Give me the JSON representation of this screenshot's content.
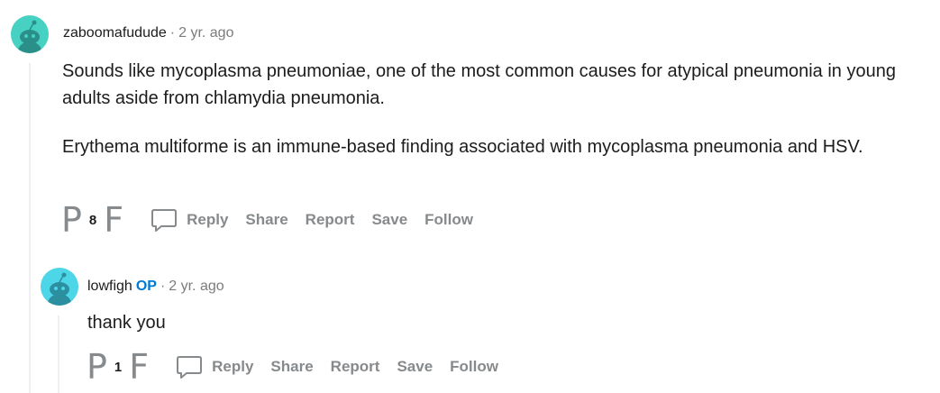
{
  "comments": [
    {
      "username": "zaboomafudude",
      "op_badge": "",
      "separator": "·",
      "time": "2 yr. ago",
      "paragraphs": [
        "Sounds like mycoplasma pneumoniae, one of the most common causes for atypical pneumonia in young adults aside from chlamydia pneumonia.",
        "Erythema multiforme is an immune-based finding associated with mycoplasma pneumonia and HSV."
      ],
      "score": "8",
      "upvote_glyph": "P",
      "downvote_glyph": "F",
      "actions": {
        "reply": "Reply",
        "share": "Share",
        "report": "Report",
        "save": "Save",
        "follow": "Follow"
      }
    },
    {
      "username": "lowfigh",
      "op_badge": "OP",
      "separator": "·",
      "time": "2 yr. ago",
      "paragraphs": [
        "thank you"
      ],
      "score": "1",
      "upvote_glyph": "P",
      "downvote_glyph": "F",
      "actions": {
        "reply": "Reply",
        "share": "Share",
        "report": "Report",
        "save": "Save",
        "follow": "Follow"
      }
    }
  ],
  "colors": {
    "avatar1": "#46d1c2",
    "avatar2": "#4dd5e8",
    "op": "#0079d3",
    "muted": "#878a8c"
  }
}
